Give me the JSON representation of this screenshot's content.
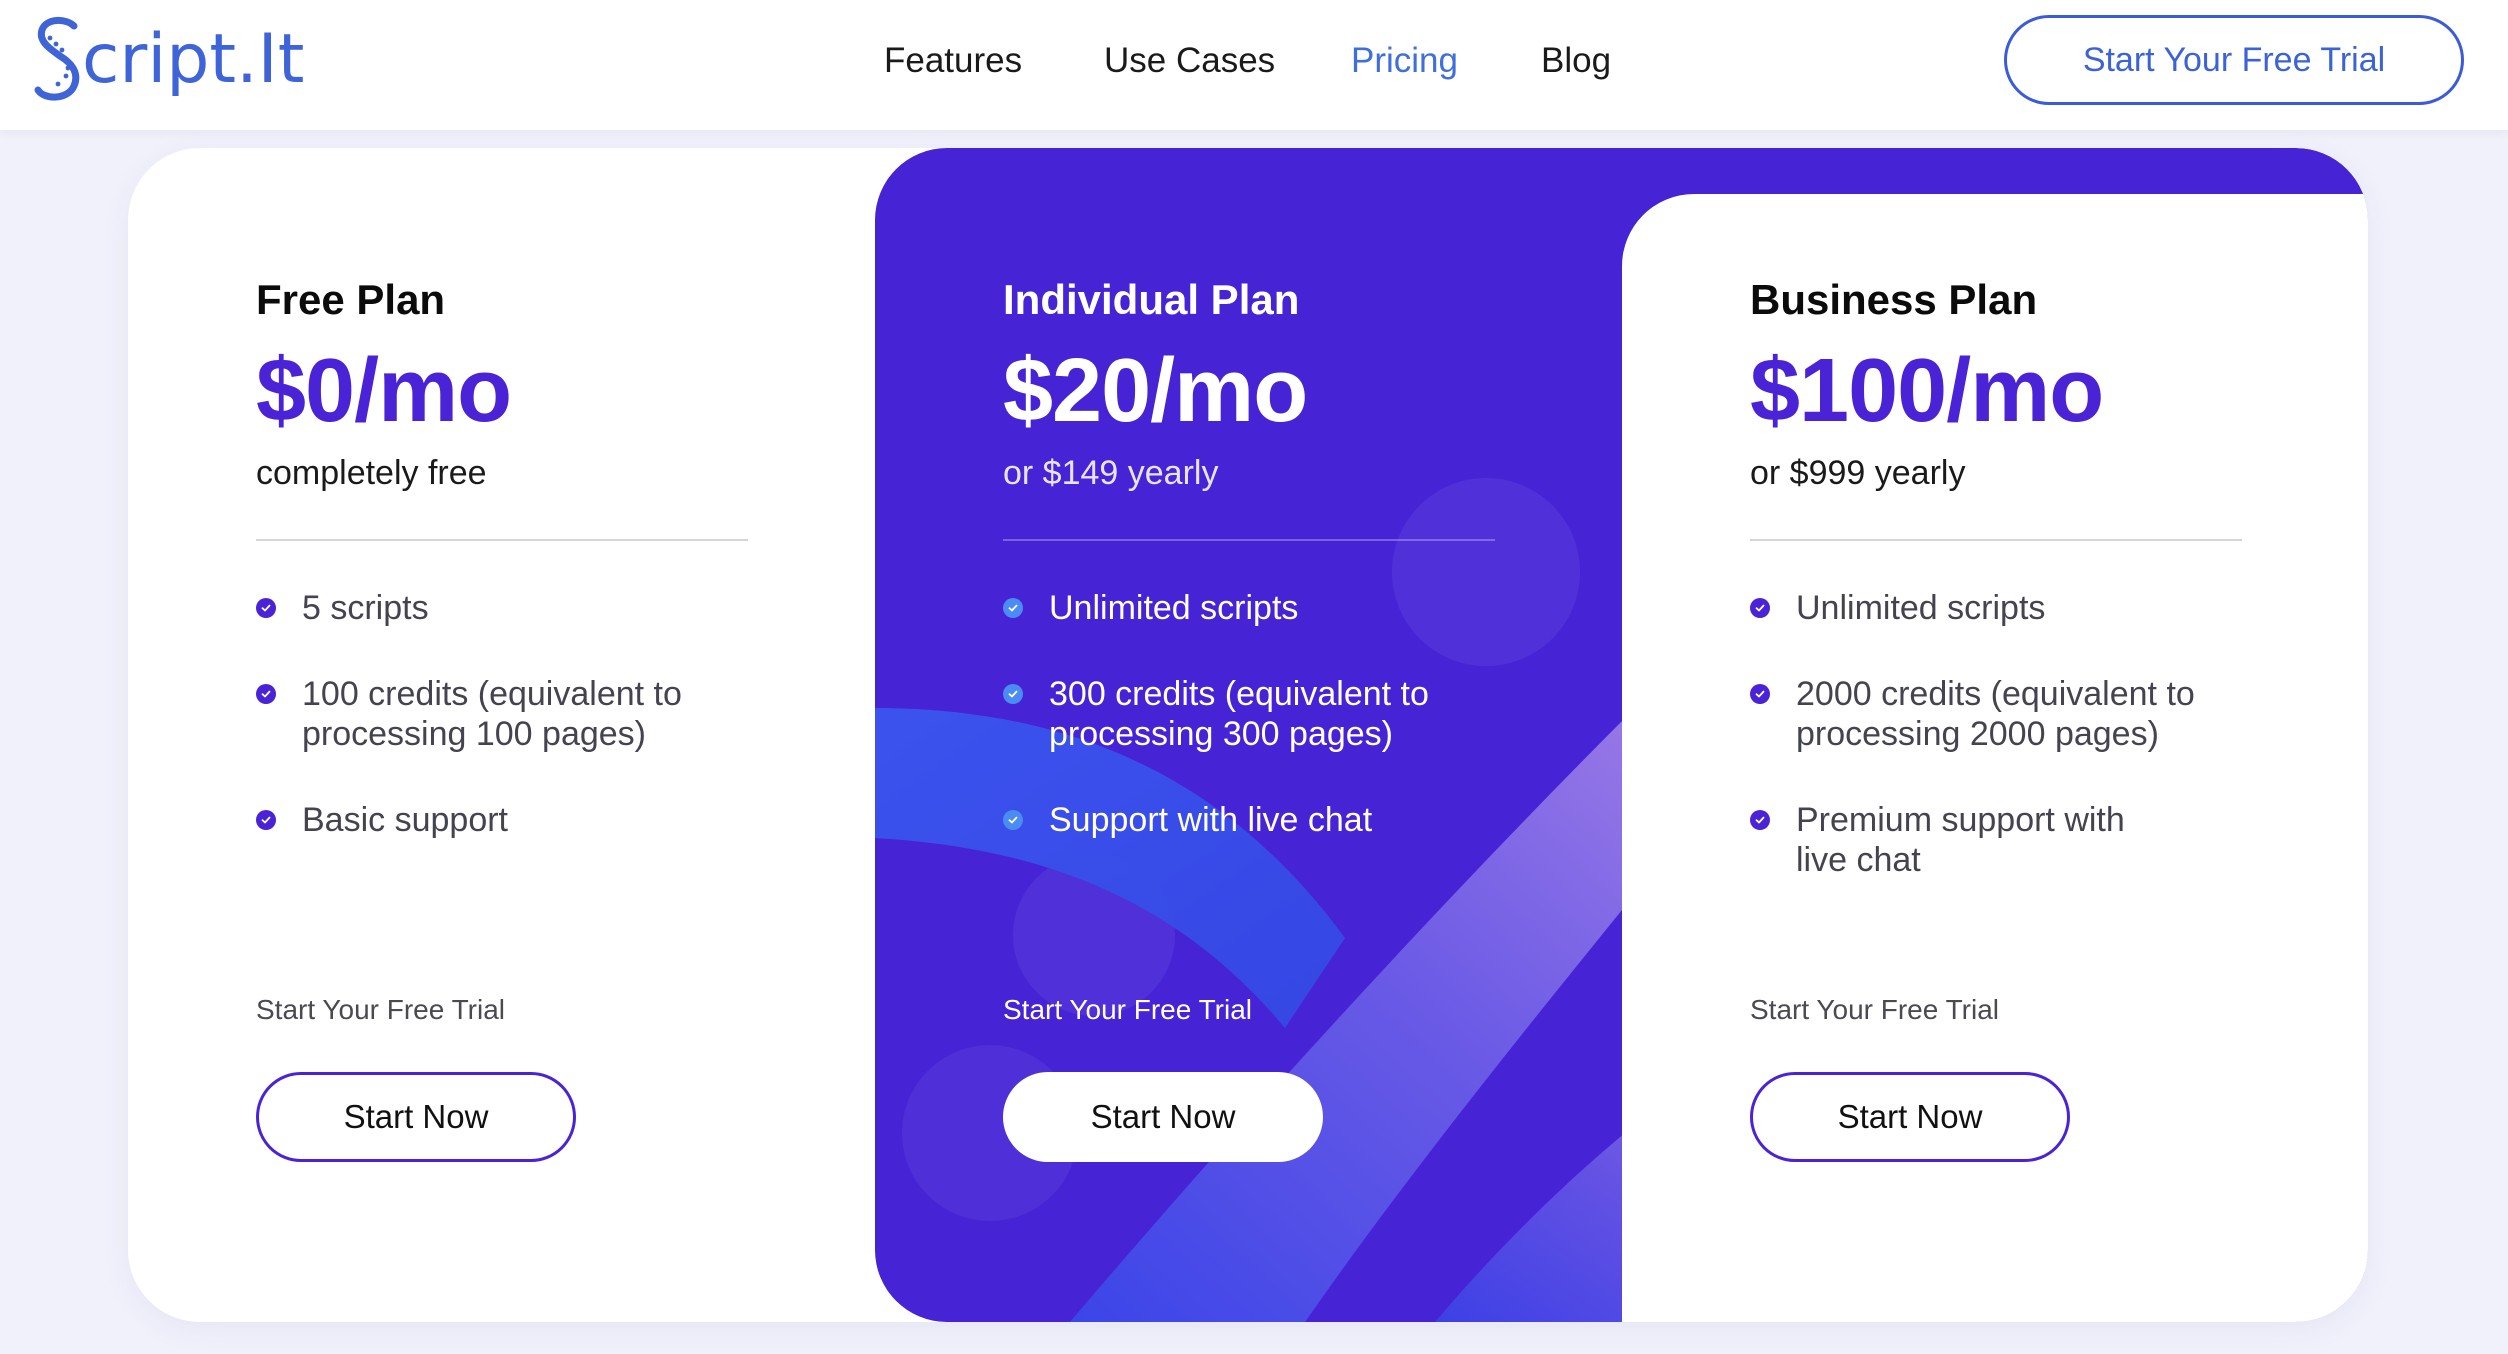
{
  "brand": {
    "logo_text": "cript.It",
    "logo_icon": "s-chain-logo-icon",
    "color": "#3f64d8"
  },
  "nav": {
    "items": [
      {
        "label": "Features"
      },
      {
        "label": "Use Cases"
      },
      {
        "label": "Pricing",
        "active": true
      },
      {
        "label": "Blog"
      }
    ],
    "active_color": "#3f6fdb",
    "cta_label": "Start Your Free Trial"
  },
  "plans": [
    {
      "title": "Free Plan",
      "price": "$0/mo",
      "subtitle": "completely free",
      "features": [
        {
          "line1": "5 scripts",
          "line2": ""
        },
        {
          "line1": "100 credits (equivalent to",
          "line2": "processing 100 pages)"
        },
        {
          "line1": "Basic support",
          "line2": ""
        }
      ],
      "trial_label": "Start Your Free Trial",
      "button_label": "Start Now"
    },
    {
      "title": "Individual Plan",
      "price": "$20/mo",
      "subtitle": "or $149 yearly",
      "features": [
        {
          "line1": "Unlimited scripts",
          "line2": ""
        },
        {
          "line1": "300 credits (equivalent to",
          "line2": "processing 300 pages)"
        },
        {
          "line1": "Support with live chat",
          "line2": ""
        }
      ],
      "trial_label": "Start Your Free Trial",
      "button_label": "Start Now",
      "highlight": true
    },
    {
      "title": "Business Plan",
      "price": "$100/mo",
      "subtitle": "or $999 yearly",
      "features": [
        {
          "line1": "Unlimited scripts",
          "line2": ""
        },
        {
          "line1": "2000 credits (equivalent to",
          "line2": "processing 2000 pages)"
        },
        {
          "line1": "Premium support with",
          "line2": "live chat"
        }
      ],
      "trial_label": "Start Your Free Trial",
      "button_label": "Start Now"
    }
  ],
  "colors": {
    "accent_purple": "#4b23d6",
    "highlight_bg": "#4624d6",
    "page_bg": "#f0f1fb"
  },
  "icons": {
    "feature_bullet": "check-circle-icon"
  }
}
